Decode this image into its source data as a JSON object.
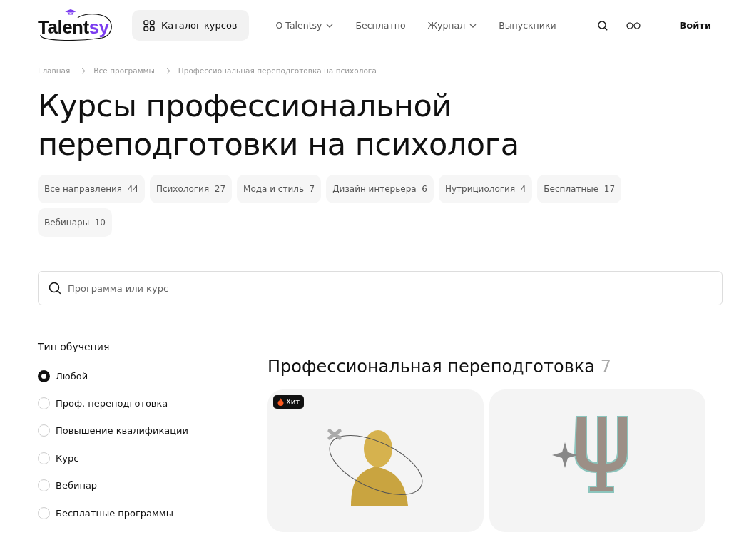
{
  "header": {
    "logo": {
      "text": "Talent",
      "accent": "sy"
    },
    "catalog_button": "Каталог курсов",
    "nav": [
      {
        "label": "О Talentsy",
        "dropdown": true
      },
      {
        "label": "Бесплатно",
        "dropdown": false
      },
      {
        "label": "Журнал",
        "dropdown": true
      },
      {
        "label": "Выпускники",
        "dropdown": false
      }
    ],
    "login": "Войти"
  },
  "breadcrumbs": [
    "Главная",
    "Все программы",
    "Профессиональная переподготовка на психолога"
  ],
  "title": "Курсы профессиональной переподготовки на психолога",
  "categories": [
    {
      "label": "Все направления",
      "count": "44"
    },
    {
      "label": "Психология",
      "count": "27"
    },
    {
      "label": "Мода и стиль",
      "count": "7"
    },
    {
      "label": "Дизайн интерьера",
      "count": "6"
    },
    {
      "label": "Нутрициология",
      "count": "4"
    },
    {
      "label": "Бесплатные",
      "count": "17"
    },
    {
      "label": "Вебинары",
      "count": "10"
    }
  ],
  "search": {
    "placeholder": "Программа или курс"
  },
  "filter": {
    "title": "Тип обучения",
    "options": [
      {
        "label": "Любой",
        "selected": true
      },
      {
        "label": "Проф. переподготовка",
        "selected": false
      },
      {
        "label": "Повышение квалификации",
        "selected": false
      },
      {
        "label": "Курс",
        "selected": false
      },
      {
        "label": "Вебинар",
        "selected": false
      },
      {
        "label": "Бесплатные программы",
        "selected": false
      }
    ]
  },
  "section": {
    "title": "Профессиональная переподготовка",
    "count": "7"
  },
  "cards": [
    {
      "kind": "bust",
      "badge": "Хит"
    },
    {
      "kind": "psi"
    }
  ]
}
